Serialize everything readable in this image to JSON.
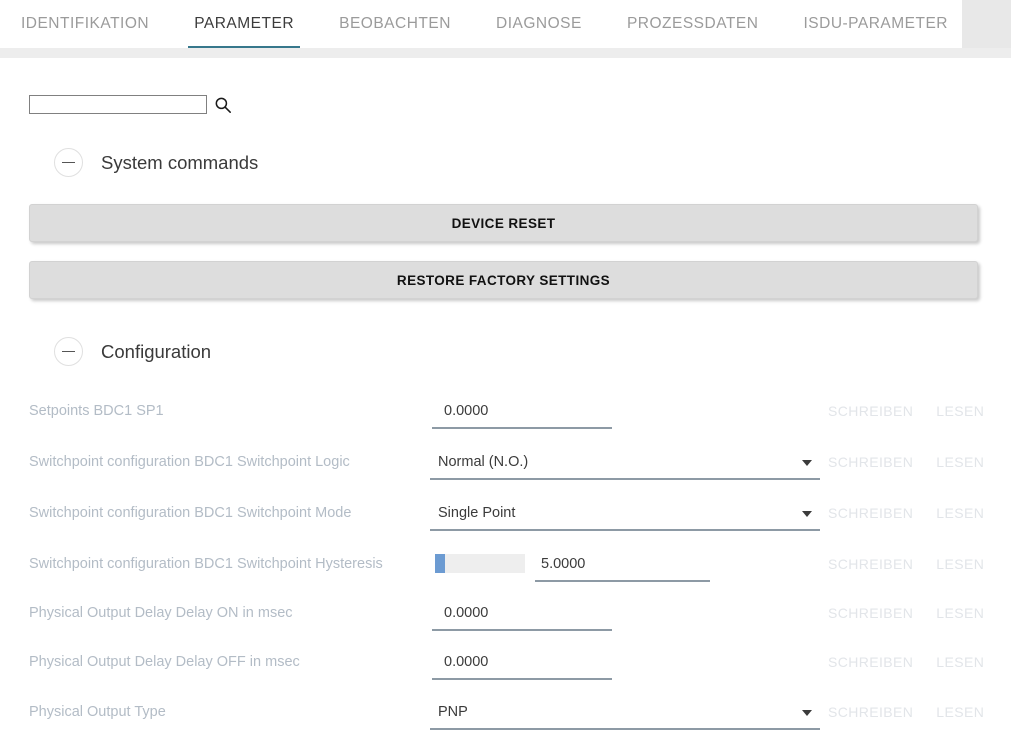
{
  "tabs": [
    {
      "label": "IDENTIFIKATION",
      "active": false
    },
    {
      "label": "PARAMETER",
      "active": true
    },
    {
      "label": "BEOBACHTEN",
      "active": false
    },
    {
      "label": "DIAGNOSE",
      "active": false
    },
    {
      "label": "PROZESSDATEN",
      "active": false
    },
    {
      "label": "ISDU-PARAMETER",
      "active": false
    }
  ],
  "search": {
    "value": "",
    "placeholder": "",
    "icon": "search-icon"
  },
  "sections": [
    {
      "title": "System commands",
      "toggle_icon": "minus-circle-icon"
    },
    {
      "title": "Configuration",
      "toggle_icon": "minus-circle-icon"
    }
  ],
  "system_commands": {
    "buttons": [
      {
        "label": "DEVICE RESET"
      },
      {
        "label": "RESTORE FACTORY SETTINGS"
      }
    ]
  },
  "actions": {
    "write_label": "SCHREIBEN",
    "read_label": "LESEN"
  },
  "configuration": {
    "rows": [
      {
        "label": "Setpoints BDC1 SP1",
        "type": "number",
        "value": "0.0000"
      },
      {
        "label": "Switchpoint configuration BDC1 Switchpoint Logic",
        "type": "select",
        "value": "Normal (N.O.)"
      },
      {
        "label": "Switchpoint configuration BDC1 Switchpoint Mode",
        "type": "select",
        "value": "Single Point"
      },
      {
        "label": "Switchpoint configuration BDC1 Switchpoint Hysteresis",
        "type": "slider",
        "value": "5.0000",
        "slider_percent": "11"
      },
      {
        "label": "Physical Output Delay Delay ON in msec",
        "type": "number",
        "value": "0.0000"
      },
      {
        "label": "Physical Output Delay Delay OFF in msec",
        "type": "number",
        "value": "0.0000"
      },
      {
        "label": "Physical Output Type",
        "type": "select",
        "value": "PNP"
      }
    ]
  },
  "colors": {
    "accent": "#37788c",
    "slider_fill": "#6c9bd2",
    "underline": "#8d9aa5",
    "label": "#b3bcc6",
    "action_disabled": "#e2e5e9"
  }
}
